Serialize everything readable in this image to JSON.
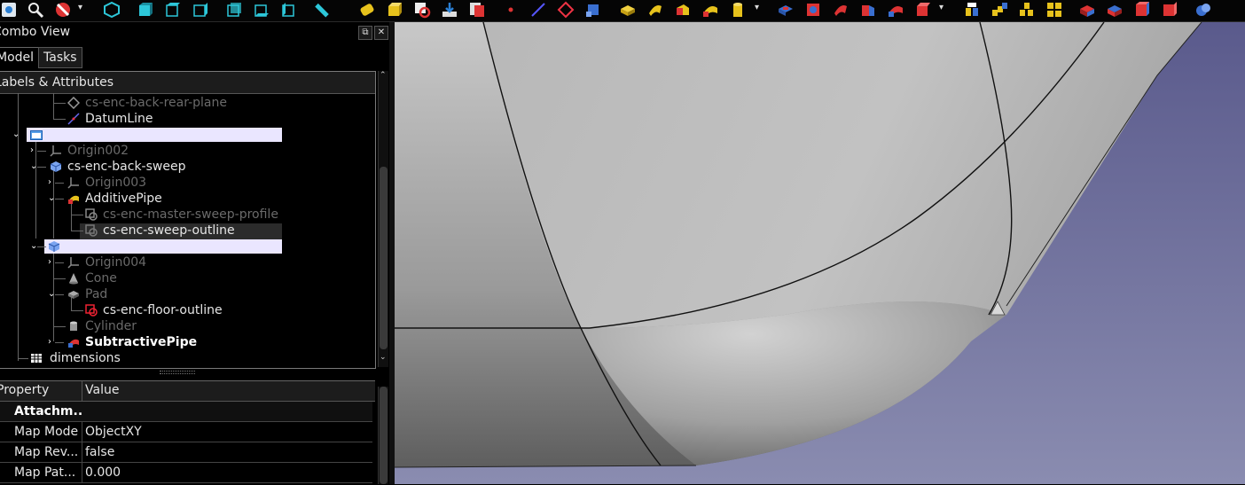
{
  "combo_view": {
    "title": "Combo View",
    "tabs": {
      "model": "Model",
      "tasks": "Tasks"
    },
    "tree_header": "Labels & Attributes"
  },
  "tree": {
    "items": [
      {
        "label": "cs-enc-back-rear-plane",
        "icon": "datum-plane-icon",
        "dim": true
      },
      {
        "label": "DatumLine",
        "icon": "datum-line-icon",
        "dim": false
      },
      {
        "label": "",
        "icon": "folder-icon",
        "dim": false
      },
      {
        "label": "Origin002",
        "icon": "origin-icon",
        "dim": true
      },
      {
        "label": "cs-enc-back-sweep",
        "icon": "body-icon",
        "dim": false
      },
      {
        "label": "Origin003",
        "icon": "origin-icon",
        "dim": true
      },
      {
        "label": "AdditivePipe",
        "icon": "additive-pipe-icon",
        "dim": false
      },
      {
        "label": "cs-enc-master-sweep-profile",
        "icon": "shape-binder-icon",
        "dim": true
      },
      {
        "label": "cs-enc-sweep-outline",
        "icon": "shape-binder-icon",
        "dim": false
      },
      {
        "label": "",
        "icon": "body-icon",
        "dim": false
      },
      {
        "label": "Origin004",
        "icon": "origin-icon",
        "dim": true
      },
      {
        "label": "Cone",
        "icon": "cone-icon",
        "dim": true
      },
      {
        "label": "Pad",
        "icon": "pad-icon",
        "dim": true
      },
      {
        "label": "cs-enc-floor-outline",
        "icon": "shape-binder-icon",
        "dim": false
      },
      {
        "label": "Cylinder",
        "icon": "cylinder-icon",
        "dim": true
      },
      {
        "label": "SubtractivePipe",
        "icon": "subtractive-pipe-icon",
        "dim": false
      },
      {
        "label": "dimensions",
        "icon": "spreadsheet-icon",
        "dim": false
      }
    ]
  },
  "property_view": {
    "columns": {
      "property": "Property",
      "value": "Value"
    },
    "group": "Attachm..",
    "rows": [
      {
        "name": "Map Mode",
        "value": "ObjectXY"
      },
      {
        "name": "Map Rev...",
        "value": "false"
      },
      {
        "name": "Map Pat...",
        "value": "0.000"
      }
    ]
  },
  "colors": {
    "highlight": "#eae6ff",
    "background_top": "#5a5a8c",
    "background_bottom": "#8a8cb0",
    "shape": "#bcbcbc"
  }
}
